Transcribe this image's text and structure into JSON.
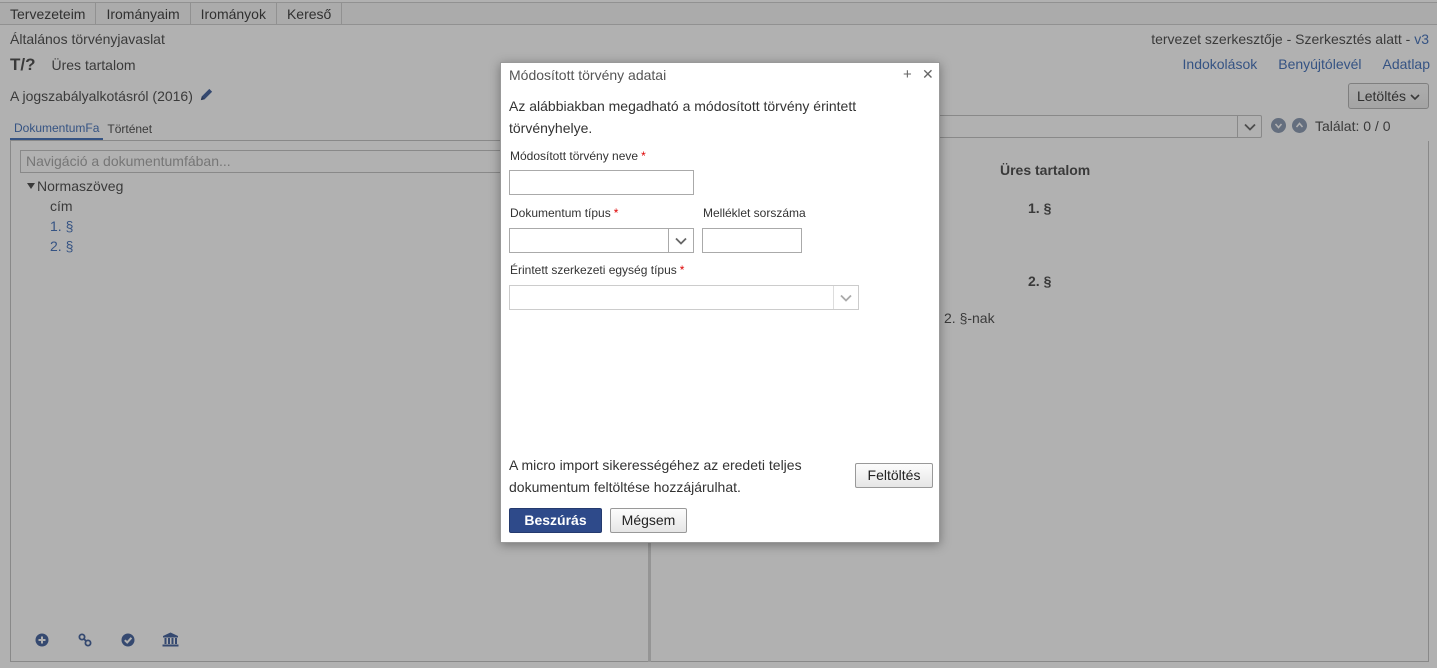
{
  "menu": [
    "Tervezeteim",
    "Irományaim",
    "Irományok",
    "Kereső"
  ],
  "header": {
    "doc_type": "Általános törvényjavaslat",
    "status": "tervezet szerkesztője - Szerkesztés alatt - ",
    "version": "v3",
    "id": "T/?",
    "title": "Üres tartalom",
    "law_name": "A jogszabályalkotásról (2016)",
    "links": [
      "Indokolások",
      "Benyújtólevél",
      "Adatlap"
    ],
    "download_label": "Letöltés"
  },
  "left": {
    "tabs": [
      "DokumentumFa",
      "Történet"
    ],
    "search_placeholder": "Navigáció a dokumentumfában...",
    "tree": {
      "root": "Normaszöveg",
      "children": [
        "cím",
        "1. §",
        "2. §"
      ]
    },
    "bottom_icons": [
      "add-circle-icon",
      "link-icon",
      "check-circle-icon",
      "bank-icon"
    ]
  },
  "right": {
    "hits": "Találat: 0 / 0",
    "doc_title": "Üres tartalom",
    "section1": "1. §",
    "section2": "2. §",
    "text": "2. §-nak"
  },
  "dialog": {
    "title": "Módosított törvény adatai",
    "description": "Az alábbiakban megadható a módosított törvény érintett törvényhelye.",
    "law_name_label": "Módosított törvény neve",
    "doc_type_label": "Dokumentum típus",
    "annex_label": "Melléklet sorszáma",
    "unit_type_label": "Érintett szerkezeti egység típus",
    "required_mark": "*",
    "note": "A micro import sikerességéhez az eredeti teljes dokumentum feltöltése hozzájárulhat.",
    "upload_label": "Feltöltés",
    "insert_label": "Beszúrás",
    "cancel_label": "Mégsem"
  },
  "colors": {
    "link": "#2a5db0",
    "primary_button": "#2e4a8a"
  }
}
